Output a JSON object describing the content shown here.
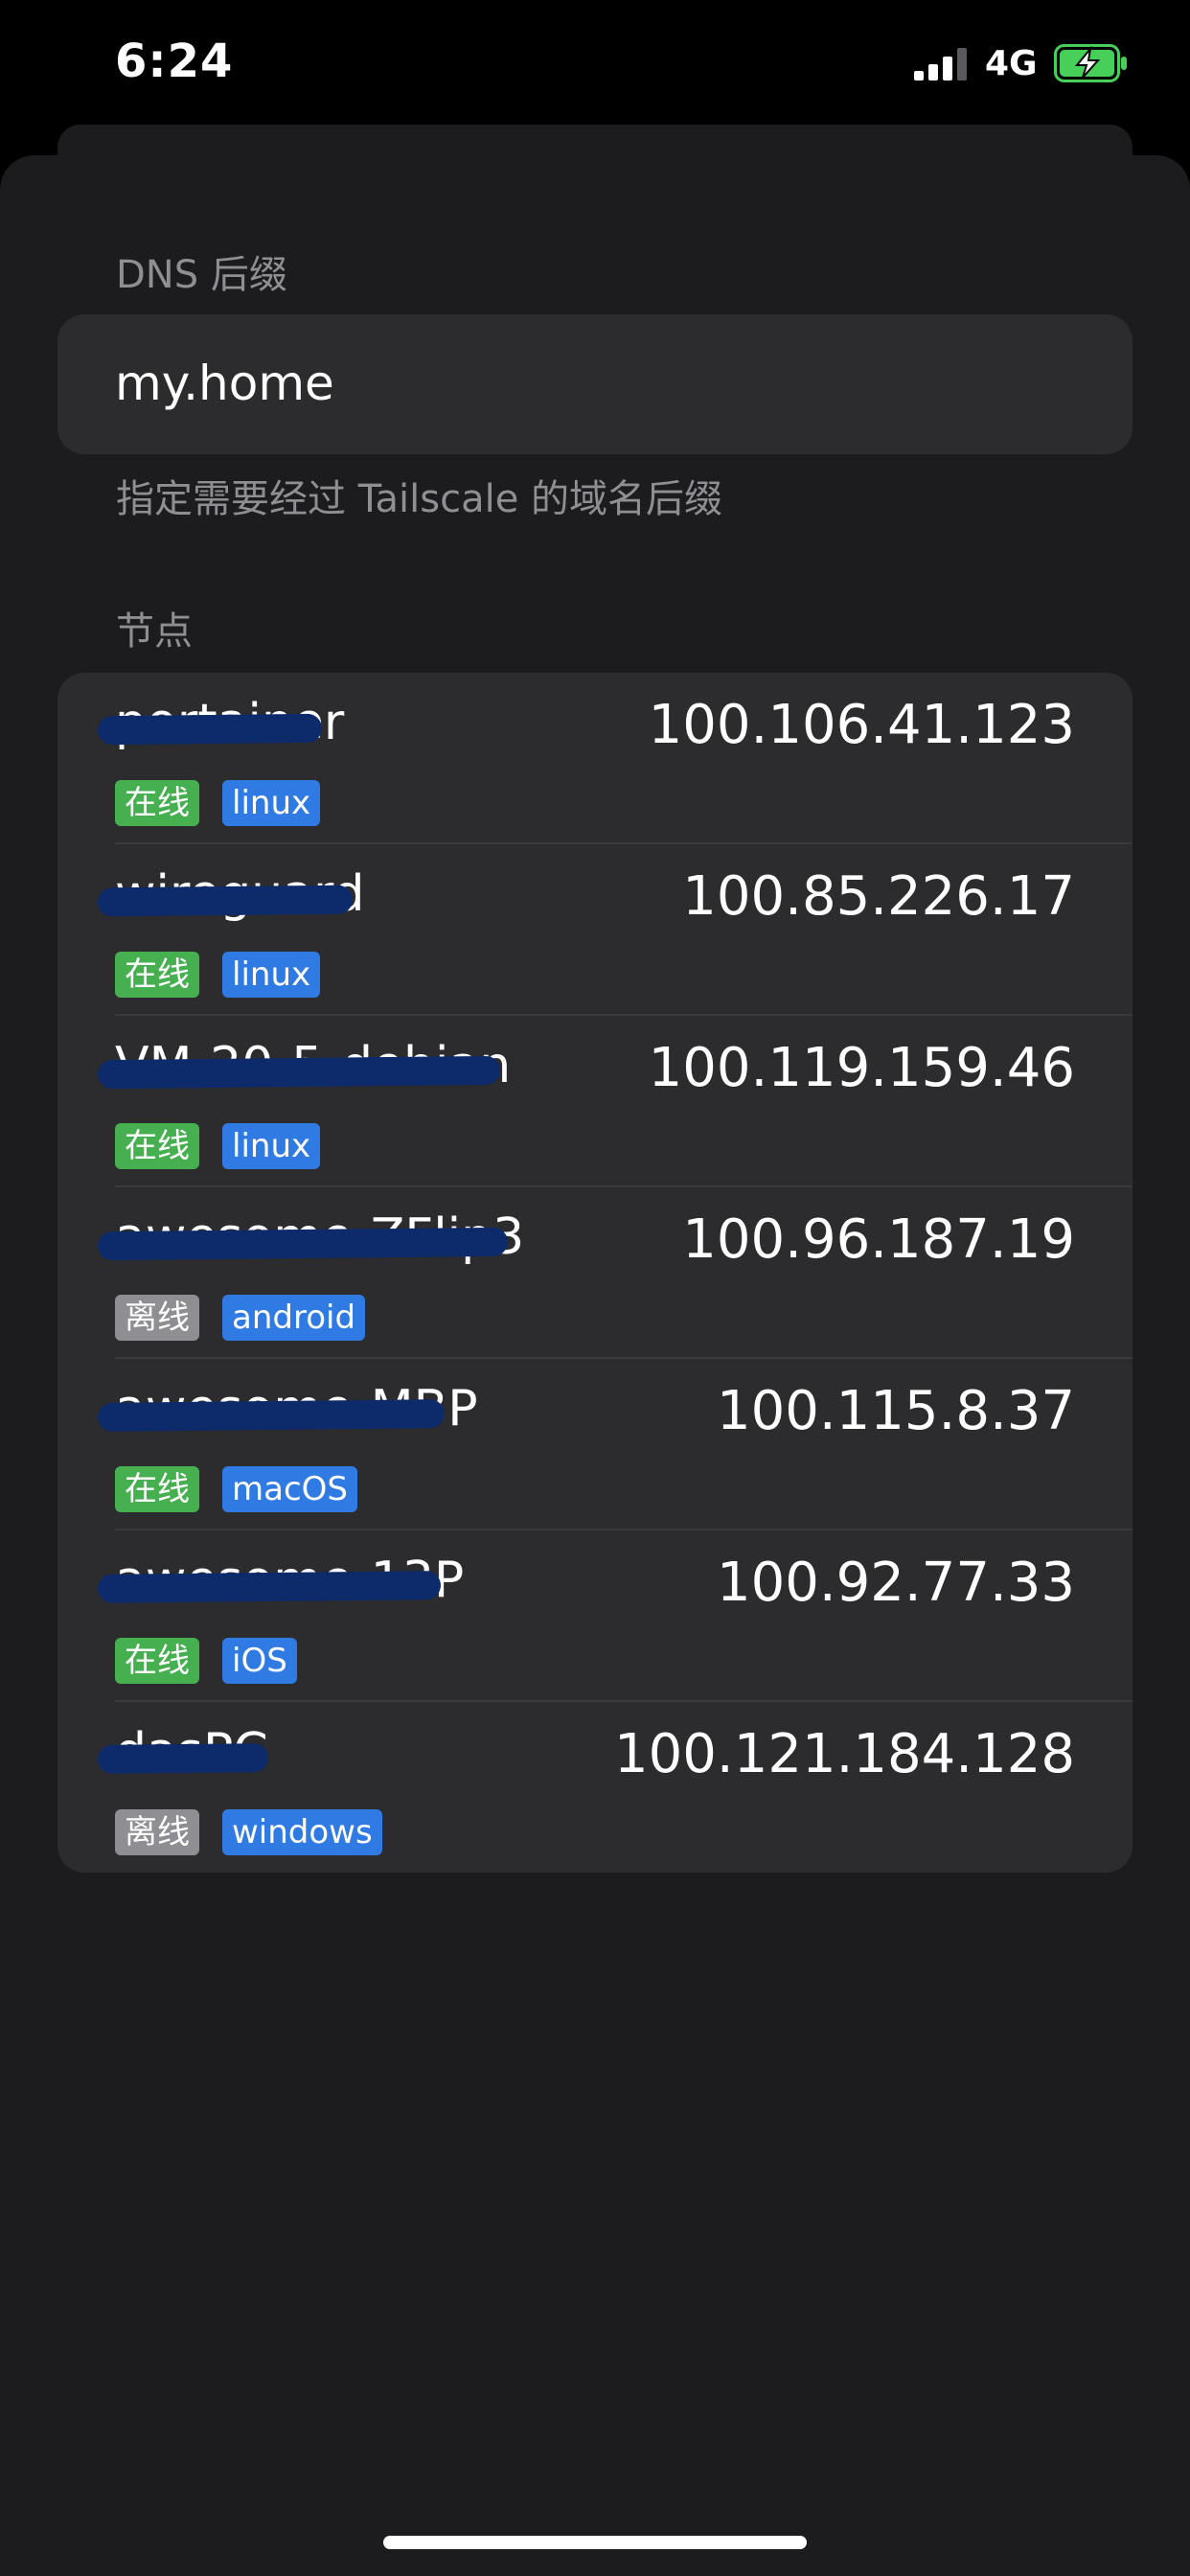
{
  "status_bar": {
    "time": "6:24",
    "network": "4G",
    "signal_icon": "signal-bars-icon",
    "battery_icon": "battery-charging-icon"
  },
  "dns": {
    "section_title": "DNS 后缀",
    "value": "my.home",
    "footer": "指定需要经过 Tailscale 的域名后缀"
  },
  "nodes": {
    "section_title": "节点",
    "items": [
      {
        "name": "portainer",
        "ip": "100.106.41.123",
        "status": "在线",
        "online": true,
        "os": "linux"
      },
      {
        "name": "wireguard",
        "ip": "100.85.226.17",
        "status": "在线",
        "online": true,
        "os": "linux"
      },
      {
        "name": "VM-20-5-debian",
        "ip": "100.119.159.46",
        "status": "在线",
        "online": true,
        "os": "linux"
      },
      {
        "name": "awesome-ZFlip3",
        "ip": "100.96.187.19",
        "status": "离线",
        "online": false,
        "os": "android"
      },
      {
        "name": "awesome-MBP",
        "ip": "100.115.8.37",
        "status": "在线",
        "online": true,
        "os": "macOS"
      },
      {
        "name": "awesome-13P",
        "ip": "100.92.77.33",
        "status": "在线",
        "online": true,
        "os": "iOS"
      },
      {
        "name": "dasPC",
        "ip": "100.121.184.128",
        "status": "离线",
        "online": false,
        "os": "windows"
      }
    ]
  },
  "colors": {
    "online": "#46b050",
    "offline": "#8e8e93",
    "os_badge": "#2f7be3",
    "redaction": "#0d2a6b"
  }
}
